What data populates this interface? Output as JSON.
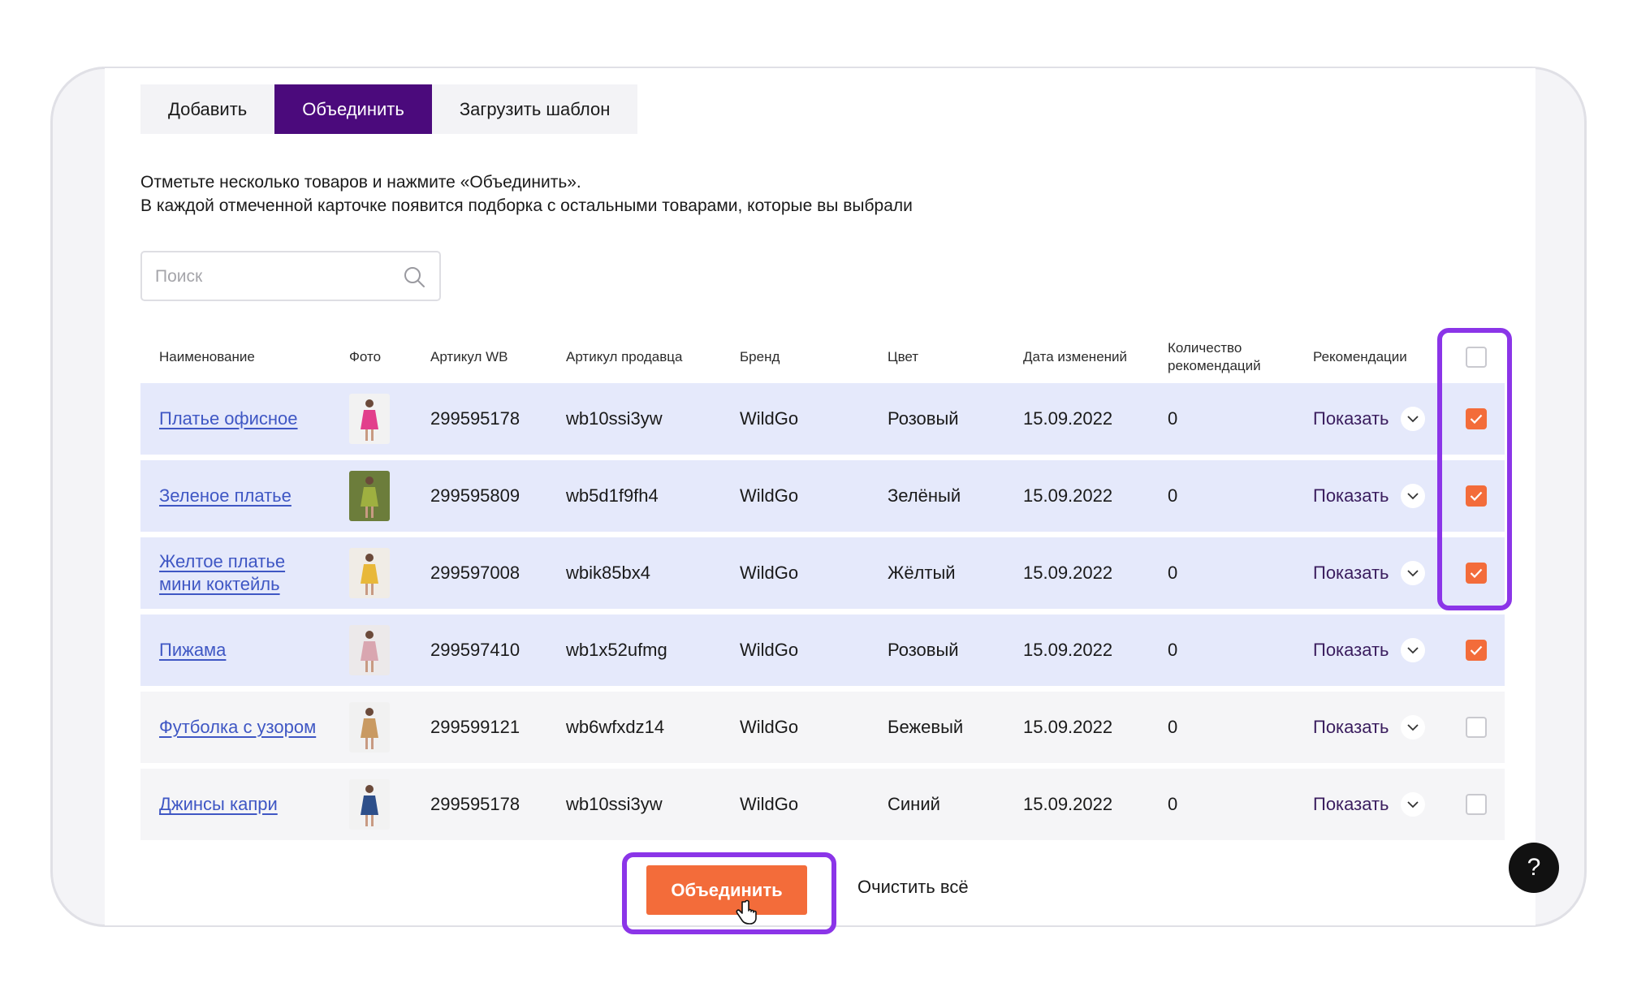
{
  "tabs": [
    {
      "label": "Добавить"
    },
    {
      "label": "Объединить"
    },
    {
      "label": "Загрузить шаблон"
    }
  ],
  "description": {
    "line1": "Отметьте несколько товаров и нажмите «Объединить».",
    "line2": "В каждой отмеченной карточке появится подборка с остальными товарами, которые вы выбрали"
  },
  "search": {
    "placeholder": "Поиск",
    "icon": "search-icon"
  },
  "table": {
    "headers": {
      "name": "Наименование",
      "photo": "Фото",
      "article_wb": "Артикул WB",
      "article_seller": "Артикул продавца",
      "brand": "Бренд",
      "color": "Цвет",
      "date": "Дата изменений",
      "rec_count": "Количество рекомендаций",
      "recs": "Рекомендации"
    },
    "select_all_checked": false,
    "rows": [
      {
        "name": "Платье офисное",
        "article_wb": "299595178",
        "article_seller": "wb10ssi3yw",
        "brand": "WildGo",
        "color": "Розовый",
        "date": "15.09.2022",
        "rec_count": "0",
        "show": "Показать",
        "checked": true
      },
      {
        "name": "Зеленое платье",
        "article_wb": "299595809",
        "article_seller": "wb5d1f9fh4",
        "brand": "WildGo",
        "color": "Зелёный",
        "date": "15.09.2022",
        "rec_count": "0",
        "show": "Показать",
        "checked": true
      },
      {
        "name": "Желтое платье мини коктейль",
        "article_wb": "299597008",
        "article_seller": "wbik85bx4",
        "brand": "WildGo",
        "color": "Жёлтый",
        "date": "15.09.2022",
        "rec_count": "0",
        "show": "Показать",
        "checked": true
      },
      {
        "name": "Пижама",
        "article_wb": "299597410",
        "article_seller": "wb1x52ufmg",
        "brand": "WildGo",
        "color": "Розовый",
        "date": "15.09.2022",
        "rec_count": "0",
        "show": "Показать",
        "checked": true
      },
      {
        "name": "Футболка с узором",
        "article_wb": "299599121",
        "article_seller": "wb6wfxdz14",
        "brand": "WildGo",
        "color": "Бежевый",
        "date": "15.09.2022",
        "rec_count": "0",
        "show": "Показать",
        "checked": false
      },
      {
        "name": "Джинсы капри",
        "article_wb": "299595178",
        "article_seller": "wb10ssi3yw",
        "brand": "WildGo",
        "color": "Синий",
        "date": "15.09.2022",
        "rec_count": "0",
        "show": "Показать",
        "checked": false
      }
    ]
  },
  "actions": {
    "merge": "Объединить",
    "clear": "Очистить всё"
  },
  "help": {
    "label": "?"
  },
  "colors": {
    "accent": "#f36c3a",
    "tab_active": "#4b0a7c",
    "highlight": "#8b35e8",
    "link": "#3f57c4",
    "selected_row": "#e5e9fb"
  }
}
